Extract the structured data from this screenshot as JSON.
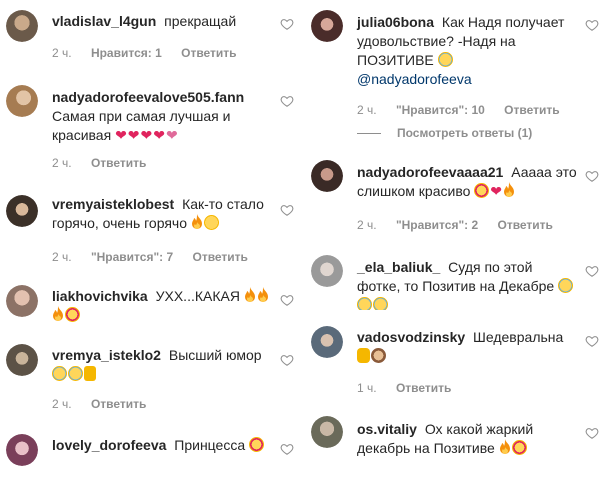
{
  "left_column": [
    {
      "username": "vladislav_l4gun",
      "text": "прекращай",
      "time": "2 ч.",
      "likes": "Нравится: 1",
      "reply": "Ответить",
      "avatar_color": "#6b5a4a"
    },
    {
      "username": "nadyadorofeevalove505.fann",
      "text": "Самая при самая лучшая и красивая",
      "time": "2 ч.",
      "likes": "",
      "reply": "Ответить",
      "avatar_color": "#a67c52"
    },
    {
      "username": "vremyaisteklobest",
      "text": "Как-то стало горячо, очень горячо",
      "time": "2 ч.",
      "likes": "\"Нравится\": 7",
      "reply": "Ответить",
      "avatar_color": "#3b3028"
    },
    {
      "username": "liakhovichvika",
      "text": "УХХ...КАКАЯ",
      "time": "",
      "likes": "",
      "reply": "",
      "avatar_color": "#8c7266"
    },
    {
      "username": "vremya_isteklo2",
      "text": "Высший юмор",
      "time": "2 ч.",
      "likes": "",
      "reply": "Ответить",
      "avatar_color": "#5c5246"
    },
    {
      "username": "lovely_dorofeeva",
      "text": "Принцесса",
      "time": "",
      "likes": "",
      "reply": "",
      "avatar_color": "#7a3f5a"
    }
  ],
  "right_column": [
    {
      "username": "julia06bona",
      "text": "Как Надя получает удовольствие? -Надя на ПОЗИТИВЕ",
      "mention": "@nadyadorofeeva",
      "time": "2 ч.",
      "likes": "\"Нравится\": 10",
      "reply": "Ответить",
      "view_replies": "Посмотреть ответы (1)",
      "avatar_color": "#4a2c2a"
    },
    {
      "username": "nadyadorofeevaaaa21",
      "text": "Ааааа это слишком красиво",
      "time": "2 ч.",
      "likes": "\"Нравится\": 2",
      "reply": "Ответить",
      "avatar_color": "#3a2a26"
    },
    {
      "username": "_ela_baliuk_",
      "text": "Судя по этой фотке, то Позитив на Декабре",
      "time": "",
      "likes": "",
      "reply": "",
      "avatar_color": "#9a9a9a"
    },
    {
      "username": "vadosvodzinsky",
      "text": "Шедевральна",
      "time": "1 ч.",
      "likes": "",
      "reply": "Ответить",
      "avatar_color": "#5a6a7a"
    },
    {
      "username": "os.vitaliy",
      "text": "Ох какой жаркий декабрь на Позитиве",
      "time": "",
      "likes": "",
      "reply": "",
      "avatar_color": "#6a6a5a"
    }
  ],
  "colors": {
    "text": "#262626",
    "meta": "#8e8e8e",
    "mention": "#00376b",
    "heart": "#e0245e"
  },
  "icons": {
    "like": "heart-outline-icon"
  }
}
